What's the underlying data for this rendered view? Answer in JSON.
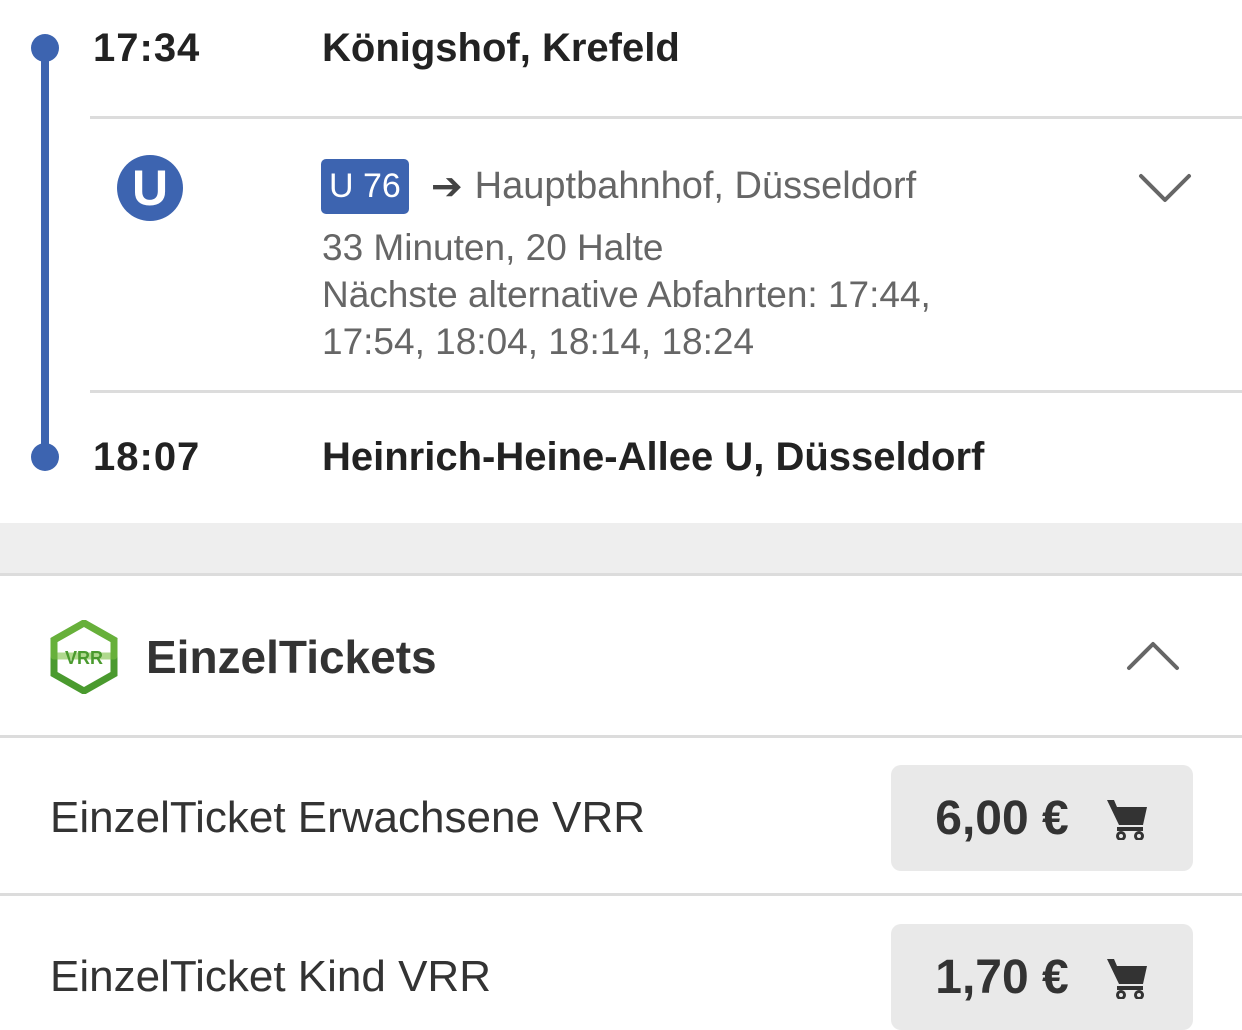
{
  "departure": {
    "time": "17:34",
    "station": "Königshof, Krefeld"
  },
  "leg": {
    "mode_icon": "U",
    "line": "U 76",
    "direction_arrow": "➔",
    "destination": "Hauptbahnhof, Düsseldorf",
    "duration_stops": "33 Minuten, 20 Halte",
    "alternatives_line1": "Nächste alternative Abfahrten: 17:44,",
    "alternatives_line2": "17:54, 18:04, 18:14, 18:24"
  },
  "arrival": {
    "time": "18:07",
    "station": "Heinrich-Heine-Allee U, Düsseldorf"
  },
  "tickets_section": {
    "logo_text": "VRR",
    "title": "EinzelTickets",
    "items": [
      {
        "name": "EinzelTicket Erwachsene VRR",
        "price": "6,00 €"
      },
      {
        "name": "EinzelTicket Kind VRR",
        "price": "1,70 €"
      }
    ]
  },
  "colors": {
    "accent": "#3d64b0",
    "vrr_green": "#4a9a2e",
    "vrr_green_light": "#7bc043"
  },
  "icons": [
    "u-bahn-icon",
    "chevron-down-icon",
    "chevron-up-icon",
    "vrr-logo-icon",
    "cart-icon"
  ]
}
